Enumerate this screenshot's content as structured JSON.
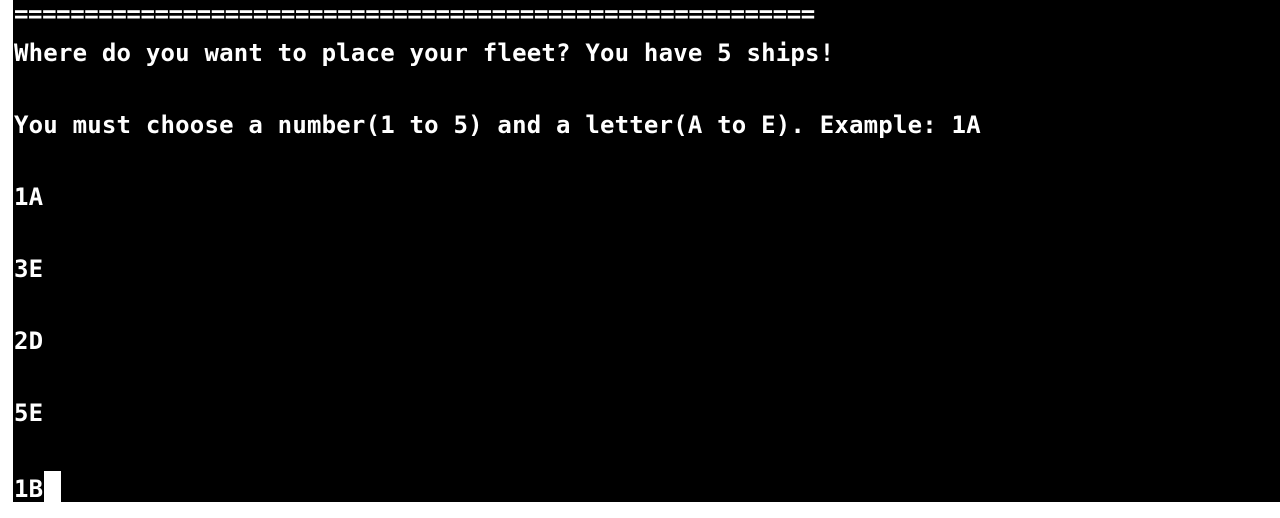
{
  "terminal": {
    "separator": "=========================================================",
    "prompt": "Where do you want to place your fleet? You have 5 ships!",
    "instructions": "You must choose a number(1 to 5) and a letter(A to E). Example: 1A",
    "entries": [
      "1A",
      "3E",
      "2D",
      "5E"
    ],
    "current_input": "1B"
  }
}
